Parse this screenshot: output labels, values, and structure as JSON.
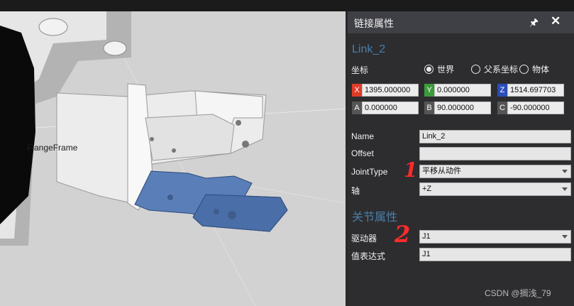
{
  "viewport": {
    "frame_label": "FlangeFrame"
  },
  "panel": {
    "title": "链接属性",
    "pin_glyph": "🖈",
    "close_glyph": "✕",
    "link_name_header": "Link_2",
    "coord_label": "坐标",
    "radios": [
      {
        "label": "世界",
        "selected": true
      },
      {
        "label": "父系坐标",
        "selected": false
      },
      {
        "label": "物体",
        "selected": false
      }
    ],
    "coords": [
      {
        "tag": "X",
        "value": "1395.000000",
        "color": "#e03c28"
      },
      {
        "tag": "Y",
        "value": "0.000000",
        "color": "#3c9a3c"
      },
      {
        "tag": "Z",
        "value": "1514.697703",
        "color": "#2a4db8"
      },
      {
        "tag": "A",
        "value": "0.000000",
        "color": "#555555"
      },
      {
        "tag": "B",
        "value": "90.000000",
        "color": "#555555"
      },
      {
        "tag": "C",
        "value": "-90.000000",
        "color": "#555555"
      }
    ],
    "props": {
      "name_label": "Name",
      "name_value": "Link_2",
      "offset_label": "Offset",
      "offset_value": "",
      "jointtype_label": "JointType",
      "jointtype_value": "平移从动件",
      "axis_label": "轴",
      "axis_value": "+Z"
    },
    "joint_header": "关节属性",
    "driver_label": "驱动器",
    "driver_value": "J1",
    "expr_label": "值表达式",
    "expr_value": "J1"
  },
  "annotations": {
    "mark1": "1",
    "mark2": "2"
  },
  "watermark": "CSDN @搁浅_79"
}
